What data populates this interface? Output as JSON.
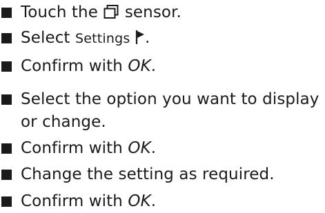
{
  "steps": [
    {
      "before": "Touch the",
      "icon": "menu-sensor-icon",
      "after": "sensor."
    },
    {
      "before": "Select",
      "ui_label": "Settings",
      "icon": "flag-icon",
      "after": "."
    },
    {
      "before": "Confirm with",
      "emphasis": "OK",
      "after": "."
    },
    {
      "line1": "Select the option you want to display",
      "line2": "or change."
    },
    {
      "before": "Confirm with",
      "emphasis": "OK",
      "after": "."
    },
    {
      "text": "Change the setting as required."
    },
    {
      "before": "Confirm with",
      "emphasis": "OK",
      "after": "."
    }
  ]
}
